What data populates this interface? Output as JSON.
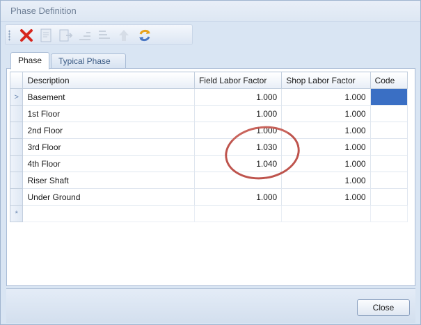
{
  "window": {
    "title": "Phase Definition"
  },
  "toolbar": {
    "buttons": [
      {
        "icon": "delete-icon",
        "color": "#d7261e"
      },
      {
        "icon": "edit-icon"
      },
      {
        "icon": "export-icon"
      },
      {
        "icon": "indent-icon"
      },
      {
        "icon": "outdent-icon"
      },
      {
        "icon": "move-up-icon"
      },
      {
        "icon": "refresh-icon"
      }
    ]
  },
  "tabs": [
    {
      "label": "Phase",
      "active": true
    },
    {
      "label": "Typical Phase",
      "active": false
    }
  ],
  "grid": {
    "columns": [
      "Description",
      "Field Labor Factor",
      "Shop Labor Factor",
      "Code"
    ],
    "rows": [
      {
        "indicator": ">",
        "description": "Basement",
        "field": "1.000",
        "shop": "1.000",
        "code": ""
      },
      {
        "indicator": "",
        "description": "1st Floor",
        "field": "1.000",
        "shop": "1.000",
        "code": ""
      },
      {
        "indicator": "",
        "description": "2nd Floor",
        "field": "1.000",
        "shop": "1.000",
        "code": ""
      },
      {
        "indicator": "",
        "description": "3rd Floor",
        "field": "1.030",
        "shop": "1.000",
        "code": ""
      },
      {
        "indicator": "",
        "description": "4th Floor",
        "field": "1.040",
        "shop": "1.000",
        "code": ""
      },
      {
        "indicator": "",
        "description": "Riser Shaft",
        "field": "",
        "shop": "1.000",
        "code": ""
      },
      {
        "indicator": "",
        "description": "Under Ground",
        "field": "1.000",
        "shop": "1.000",
        "code": ""
      },
      {
        "indicator": "*",
        "description": "",
        "field": "",
        "shop": "",
        "code": ""
      }
    ]
  },
  "footer": {
    "close_label": "Close"
  },
  "colors": {
    "selection": "#3a6fc4",
    "annotation": "#b8423a"
  }
}
